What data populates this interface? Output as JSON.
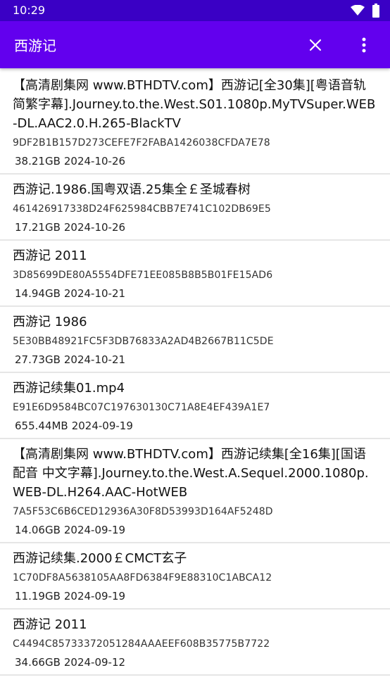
{
  "status_bar": {
    "time": "10:29",
    "wifi_icon": "wifi-icon",
    "battery_icon": "battery-icon"
  },
  "app_bar": {
    "title": "西游记",
    "close_icon": "close-icon",
    "more_icon": "more-vertical-icon",
    "color": "#6200ee",
    "status_color": "#3a00c5"
  },
  "items": [
    {
      "name": "【高清剧集网 www.BTHDTV.com】西游记[全30集][粤语音轨 简繁字幕].Journey.to.the.West.S01.1080p.MyTVSuper.WEB-DL.AAC2.0.H.265-BlackTV",
      "hash": "9DF2B1B157D273CEFE7F2FABA1426038CFDA7E78",
      "size": "38.21GB",
      "date": "2024-10-26"
    },
    {
      "name": "西游记.1986.国粤双语.25集全￡圣城春树",
      "hash": "461426917338D24F625984CBB7E741C102DB69E5",
      "size": "17.21GB",
      "date": "2024-10-26"
    },
    {
      "name": "西游记 2011",
      "hash": "3D85699DE80A5554DFE71EE085B8B5B01FE15AD6",
      "size": "14.94GB",
      "date": "2024-10-21"
    },
    {
      "name": "西游记 1986",
      "hash": "5E30BB48921FC5F3DB76833A2AD4B2667B11C5DE",
      "size": "27.73GB",
      "date": "2024-10-21"
    },
    {
      "name": "西游记续集01.mp4",
      "hash": "E91E6D9584BC07C197630130C71A8E4EF439A1E7",
      "size": "655.44MB",
      "date": "2024-09-19"
    },
    {
      "name": "【高清剧集网 www.BTHDTV.com】西游记续集[全16集][国语配音 中文字幕].Journey.to.the.West.A.Sequel.2000.1080p.WEB-DL.H264.AAC-HotWEB",
      "hash": "7A5F53C6B6CED12936A30F8D53993D164AF5248D",
      "size": "14.06GB",
      "date": "2024-09-19"
    },
    {
      "name": "西游记续集.2000￡CMCT玄子",
      "hash": "1C70DF8A5638105AA8FD6384F9E88310C1ABCA12",
      "size": "11.19GB",
      "date": "2024-09-19"
    },
    {
      "name": "西游记 2011",
      "hash": "C4494C85733372051284AAAEEF608B35775B7722",
      "size": "34.66GB",
      "date": "2024-09-12"
    }
  ]
}
